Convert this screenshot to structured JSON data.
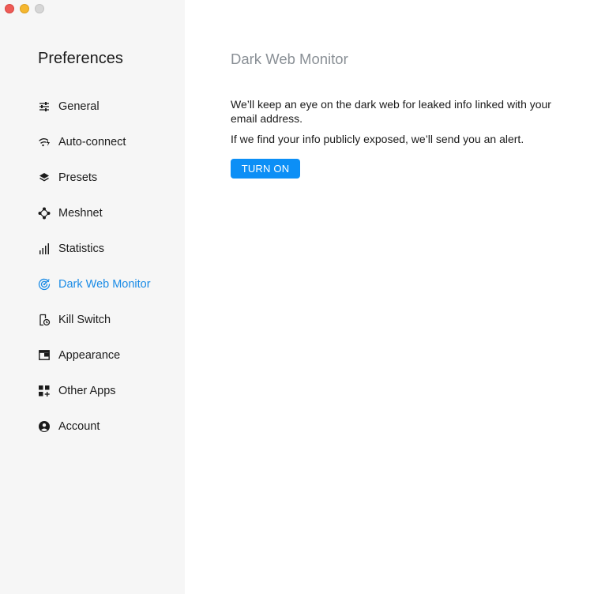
{
  "sidebar": {
    "title": "Preferences",
    "items": [
      {
        "label": "General",
        "icon": "sliders-icon"
      },
      {
        "label": "Auto-connect",
        "icon": "wifi-bolt-icon"
      },
      {
        "label": "Presets",
        "icon": "layers-icon"
      },
      {
        "label": "Meshnet",
        "icon": "meshnet-icon"
      },
      {
        "label": "Statistics",
        "icon": "bar-chart-icon"
      },
      {
        "label": "Dark Web Monitor",
        "icon": "radar-icon",
        "active": true
      },
      {
        "label": "Kill Switch",
        "icon": "kill-switch-icon"
      },
      {
        "label": "Appearance",
        "icon": "window-icon"
      },
      {
        "label": "Other Apps",
        "icon": "apps-grid-icon"
      },
      {
        "label": "Account",
        "icon": "user-circle-icon"
      }
    ]
  },
  "main": {
    "title": "Dark Web Monitor",
    "description_1": "We’ll keep an eye on the dark web for leaked info linked with your email address.",
    "description_2": "If we find your info publicly exposed, we’ll send you an alert.",
    "button_label": "TURN ON"
  },
  "colors": {
    "accent": "#0c8ff6",
    "active_text": "#1a8be6",
    "sidebar_bg": "#f6f6f6",
    "title_gray": "#8a9096"
  }
}
